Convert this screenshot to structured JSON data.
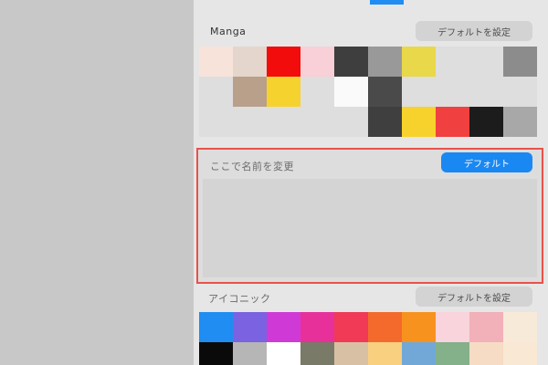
{
  "manga": {
    "label": "Manga",
    "button_label": "デフォルトを設定",
    "colors": [
      "#f7e3da",
      "#e4d6cc",
      "#f20c0c",
      "#f9cfd8",
      "#3e3e3e",
      "#999999",
      "#e8d84a",
      "#dedede",
      "#dedede",
      "#8c8c8c",
      "#dedede",
      "#b8a08a",
      "#f6d22e",
      "#dedede",
      "#fafafa",
      "#4a4a4a",
      "#dedede",
      "#dedede",
      "#dedede",
      "#dedede",
      "#dedede",
      "#dedede",
      "#dedede",
      "#dedede",
      "#dedede",
      "#3f3f3f",
      "#f8d22c",
      "#f04040",
      "#1c1c1c",
      "#a8a8a8"
    ]
  },
  "custom": {
    "label": "ここで名前を変更",
    "button_label": "デフォルト"
  },
  "iconic": {
    "label": "アイコニック",
    "button_label": "デフォルトを設定",
    "colors": [
      "#1f8df2",
      "#7b62e0",
      "#cf3ad6",
      "#e8309a",
      "#f03a56",
      "#f46a2c",
      "#f8921e",
      "#f9d4dc",
      "#f2b0b8",
      "#f8ead8",
      "#0a0a0a",
      "#b6b6b6",
      "#ffffff",
      "#7a7a68",
      "#d8c0a4",
      "#f8d080",
      "#72a8d8",
      "#84b08a",
      "#f6dcc4",
      "#f8e8d4"
    ]
  }
}
